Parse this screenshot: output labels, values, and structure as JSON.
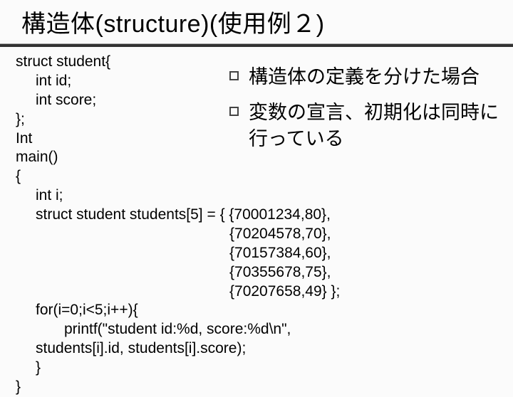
{
  "title": "構造体(structure)(使用例２)",
  "code_top": {
    "l1": "struct student{",
    "l2": "int id;",
    "l3": "int score;",
    "l4": "};",
    "l5": "",
    "l6": "Int",
    "l7": "main()",
    "l8": "{"
  },
  "bullets": [
    "構造体の定義を分けた場合",
    "変数の宣言、初期化は同時に行っている"
  ],
  "code_body": {
    "b1": "int i;",
    "b2": "struct student students[5] = { {70001234,80},",
    "b3": "{70204578,70},",
    "b4": "{70157384,60},",
    "b5": "{70355678,75},",
    "b6": "{70207658,49} };",
    "b7": "for(i=0;i<5;i++){",
    "b8": "printf(\"student id:%d, score:%d\\n\",",
    "b9": "students[i].id, students[i].score);",
    "b10": "}",
    "b11": "}"
  }
}
